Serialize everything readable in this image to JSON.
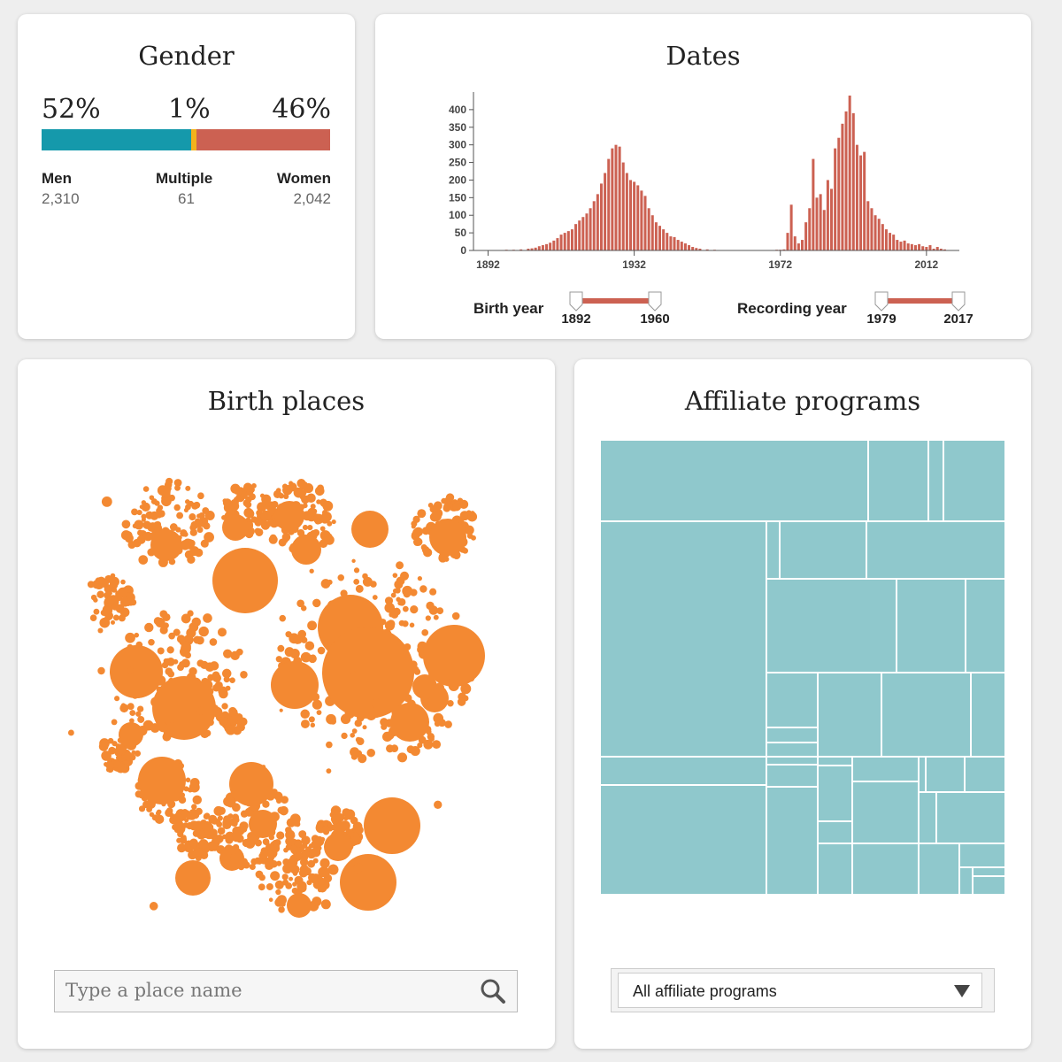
{
  "gender": {
    "title": "Gender",
    "men": {
      "percent_label": "52%",
      "label": "Men",
      "count": "2,310",
      "color": "#1599ab"
    },
    "multiple": {
      "percent_label": "1%",
      "label": "Multiple",
      "count": "61",
      "color": "#f3b21c"
    },
    "women": {
      "percent_label": "46%",
      "label": "Women",
      "count": "2,042",
      "color": "#cc6152"
    }
  },
  "dates": {
    "title": "Dates",
    "birth_label": "Birth year",
    "birth_min": "1892",
    "birth_max": "1960",
    "recording_label": "Recording year",
    "recording_min": "1979",
    "recording_max": "2017",
    "bar_color": "#cc6152"
  },
  "chart_data": {
    "type": "bar",
    "title": "Dates",
    "x_ticks": [
      "1892",
      "1932",
      "1972",
      "2012"
    ],
    "y_ticks": [
      "0",
      "50",
      "100",
      "150",
      "200",
      "250",
      "300",
      "350",
      "400"
    ],
    "ylim": [
      0,
      450
    ],
    "xlim": [
      1888,
      2021
    ],
    "series": [
      {
        "years": [
          1897,
          1899,
          1901,
          1903,
          1904,
          1905,
          1906,
          1907,
          1908,
          1909,
          1910,
          1911,
          1912,
          1913,
          1914,
          1915,
          1916,
          1917,
          1918,
          1919,
          1920,
          1921,
          1922,
          1923,
          1924,
          1925,
          1926,
          1927,
          1928,
          1929,
          1930,
          1931,
          1932,
          1933,
          1934,
          1935,
          1936,
          1937,
          1938,
          1939,
          1940,
          1941,
          1942,
          1943,
          1944,
          1945,
          1946,
          1947,
          1948,
          1949,
          1950,
          1952,
          1954
        ],
        "values": [
          2,
          2,
          3,
          5,
          6,
          8,
          12,
          15,
          18,
          22,
          28,
          35,
          45,
          50,
          55,
          60,
          75,
          85,
          95,
          105,
          120,
          140,
          160,
          190,
          220,
          260,
          290,
          300,
          295,
          250,
          220,
          200,
          195,
          185,
          170,
          155,
          120,
          100,
          80,
          70,
          60,
          50,
          40,
          38,
          30,
          25,
          20,
          15,
          10,
          7,
          5,
          3,
          2
        ]
      },
      {
        "years": [
          1971,
          1972,
          1973,
          1974,
          1975,
          1976,
          1977,
          1978,
          1979,
          1980,
          1981,
          1982,
          1983,
          1984,
          1985,
          1986,
          1987,
          1988,
          1989,
          1990,
          1991,
          1992,
          1993,
          1994,
          1995,
          1996,
          1997,
          1998,
          1999,
          2000,
          2001,
          2002,
          2003,
          2004,
          2005,
          2006,
          2007,
          2008,
          2009,
          2010,
          2011,
          2012,
          2013,
          2014,
          2015,
          2016,
          2017
        ],
        "values": [
          2,
          2,
          3,
          50,
          130,
          40,
          20,
          30,
          80,
          120,
          260,
          150,
          160,
          115,
          200,
          175,
          290,
          320,
          360,
          395,
          440,
          390,
          300,
          270,
          280,
          140,
          120,
          100,
          90,
          75,
          60,
          50,
          45,
          30,
          25,
          28,
          20,
          18,
          15,
          18,
          12,
          10,
          15,
          5,
          10,
          5,
          3
        ]
      }
    ]
  },
  "places": {
    "title": "Birth places",
    "search_placeholder": "Type a place name",
    "bubble_color": "#f38932"
  },
  "affiliates": {
    "title": "Affiliate programs",
    "select_value": "All affiliate programs",
    "tile_color": "#8fc8cc"
  },
  "icons": {
    "search": "search-icon",
    "dropdown": "triangle-down-icon",
    "handle": "slider-handle-icon"
  }
}
